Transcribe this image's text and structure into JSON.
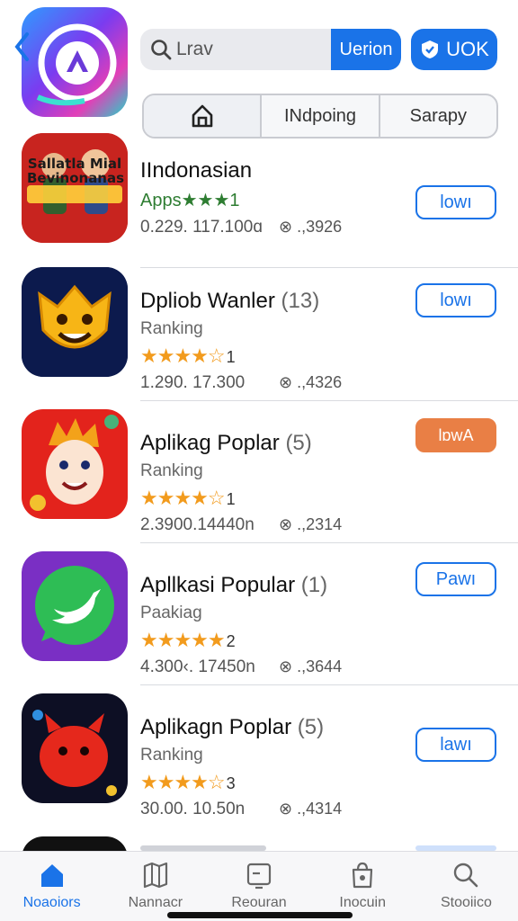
{
  "header": {
    "search": {
      "value": "",
      "placeholder": "Lrav",
      "button_label": "Uerion"
    },
    "ok_button_label": "UOK",
    "segments": [
      {
        "label": "",
        "icon": "home-icon"
      },
      {
        "label": "INdpoing"
      },
      {
        "label": "Sarapy"
      }
    ]
  },
  "apps": [
    {
      "name": "IIndonasian",
      "count": "",
      "subtitle": "Apps★★★1",
      "stars": "",
      "rating": "",
      "downloads": "0.229. 117.100ɑ",
      "reviews": "⊗ .,3926",
      "button": "lowı",
      "icon_text": "Sallatla Mial Bevinonanas"
    },
    {
      "name": "Dpliob Wanler",
      "count": "(13)",
      "subtitle": "Ranking",
      "stars": "★★★★☆",
      "rating": "1",
      "downloads": "1.290. 17.300",
      "reviews": "⊗ .,4326",
      "button": "lowı"
    },
    {
      "name": "Aplikag Poplar",
      "count": "(5)",
      "subtitle": "Ranking",
      "stars": "★★★★☆",
      "rating": "1",
      "downloads": "2.3900.14440n",
      "reviews": "⊗ .,2314",
      "button": "lɒwA"
    },
    {
      "name": "Apllkasi Popular",
      "count": "(1)",
      "subtitle": "Paakiag",
      "stars": "★★★★★",
      "rating": "2",
      "downloads": "4.300‹. 17450n",
      "reviews": "⊗ .,3644",
      "button": "Pawı"
    },
    {
      "name": "Aplikagn Poplar",
      "count": "(5)",
      "subtitle": "Ranking",
      "stars": "★★★★☆",
      "rating": "3",
      "downloads": "30.00. 10.50n",
      "reviews": "⊗ .,4314",
      "button": "lawı"
    }
  ],
  "tabbar": [
    {
      "label": "Noaoiors",
      "icon": "home-icon",
      "active": true
    },
    {
      "label": "Nannacr",
      "icon": "map-icon"
    },
    {
      "label": "Reouran",
      "icon": "tv-icon"
    },
    {
      "label": "Inocuin",
      "icon": "bag-icon"
    },
    {
      "label": "Stooiico",
      "icon": "search-icon"
    }
  ],
  "colors": {
    "accent": "#1a73e8",
    "orange": "#e97f45",
    "star": "#f29b1d",
    "green_text": "#2e7d32"
  }
}
